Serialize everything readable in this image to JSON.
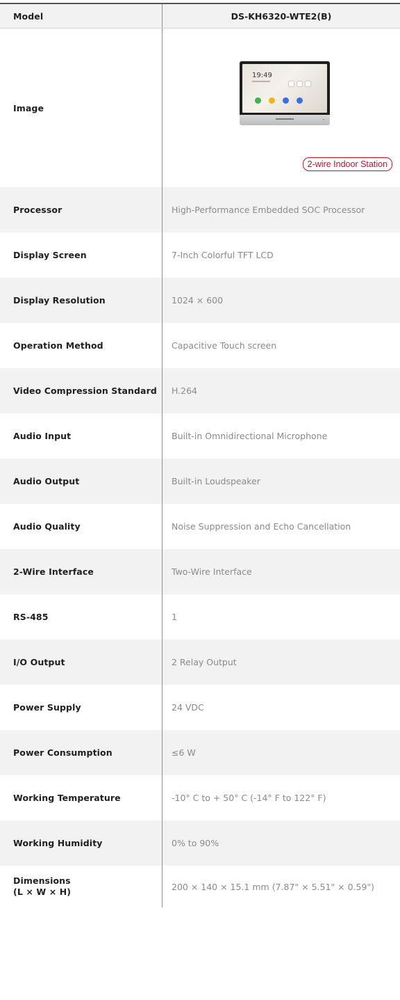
{
  "header": {
    "label": "Model",
    "value": "DS-KH6320-WTE2(B)"
  },
  "image_row": {
    "label": "Image",
    "device_time": "19:49",
    "badge": "2-wire Indoor Station"
  },
  "specs": [
    {
      "label": "Processor",
      "value": "High-Performance Embedded SOC Processor"
    },
    {
      "label": "Display Screen",
      "value": "7-Inch Colorful TFT LCD"
    },
    {
      "label": "Display Resolution",
      "value": "1024 × 600"
    },
    {
      "label": "Operation Method",
      "value": "Capacitive Touch screen"
    },
    {
      "label": "Video Compression Standard",
      "value": "H.264"
    },
    {
      "label": "Audio Input",
      "value": "Built-in Omnidirectional Microphone"
    },
    {
      "label": "Audio Output",
      "value": "Built-in Loudspeaker"
    },
    {
      "label": "Audio Quality",
      "value": "Noise Suppression and Echo Cancellation"
    },
    {
      "label": "2-Wire Interface",
      "value": "Two-Wire Interface"
    },
    {
      "label": "RS-485",
      "value": "1"
    },
    {
      "label": "I/O Output",
      "value": "2 Relay Output"
    },
    {
      "label": "Power Supply",
      "value": "24 VDC"
    },
    {
      "label": "Power Consumption",
      "value": "≤6 W"
    },
    {
      "label": "Working Temperature",
      "value": "-10° C to + 50° C (-14° F to 122° F)"
    },
    {
      "label": "Working Humidity",
      "value": "0% to 90%"
    }
  ],
  "dimensions": {
    "label_line1": "Dimensions",
    "label_line2": "(L × W × H)",
    "value": "200 × 140 × 15.1 mm (7.87\" × 5.51\" × 0.59\")"
  },
  "colors": {
    "accent": "#c8102e",
    "zebra": "#f2f2f2",
    "value_text": "#8a8a8a"
  }
}
